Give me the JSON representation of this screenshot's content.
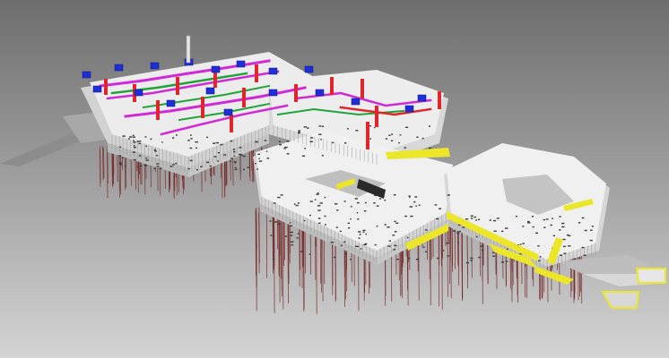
{
  "viewport": {
    "background_top": "#6e6e6e",
    "background_mid": "#9a9a9a",
    "background_bottom": "#d4d4d4"
  },
  "colors": {
    "wall": "#f2f2f2",
    "wall_shade": "#d2d2d2",
    "roof": "#e4e4e4",
    "window": "#3a3a3a",
    "ground_slab": "#8a8a8a",
    "piles": "#7a2f2f",
    "duct_red": "#e0262a",
    "duct_magenta": "#d02ad6",
    "duct_blue": "#1e2fd8",
    "duct_green": "#1fa33a",
    "highlight_yellow": "#ece62a"
  },
  "model": {
    "wings": [
      "west-wing",
      "central-link",
      "south-courtyard-block",
      "east-courtyard-block"
    ],
    "systems": [
      "structure",
      "foundation-piles",
      "mep-ductwork",
      "curtain-wall-highlight"
    ]
  }
}
